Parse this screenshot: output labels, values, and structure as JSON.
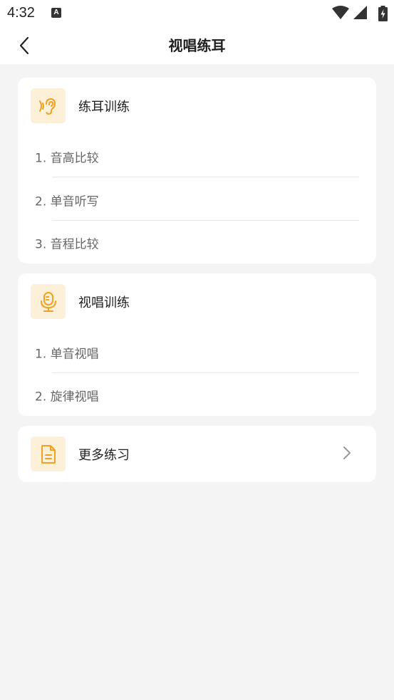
{
  "status": {
    "time": "4:32",
    "notif_letter": "A"
  },
  "header": {
    "title": "视唱练耳"
  },
  "ear_training": {
    "title": "练耳训练",
    "items": [
      {
        "label": "1. 音高比较"
      },
      {
        "label": "2. 单音听写"
      },
      {
        "label": "3. 音程比较"
      }
    ]
  },
  "sight_singing": {
    "title": "视唱训练",
    "items": [
      {
        "label": "1. 单音视唱"
      },
      {
        "label": "2. 旋律视唱"
      }
    ]
  },
  "more": {
    "title": "更多练习"
  },
  "colors": {
    "accent": "#f0a022",
    "icon_bg": "#fdf0d8",
    "page_bg": "#f4f4f4"
  }
}
